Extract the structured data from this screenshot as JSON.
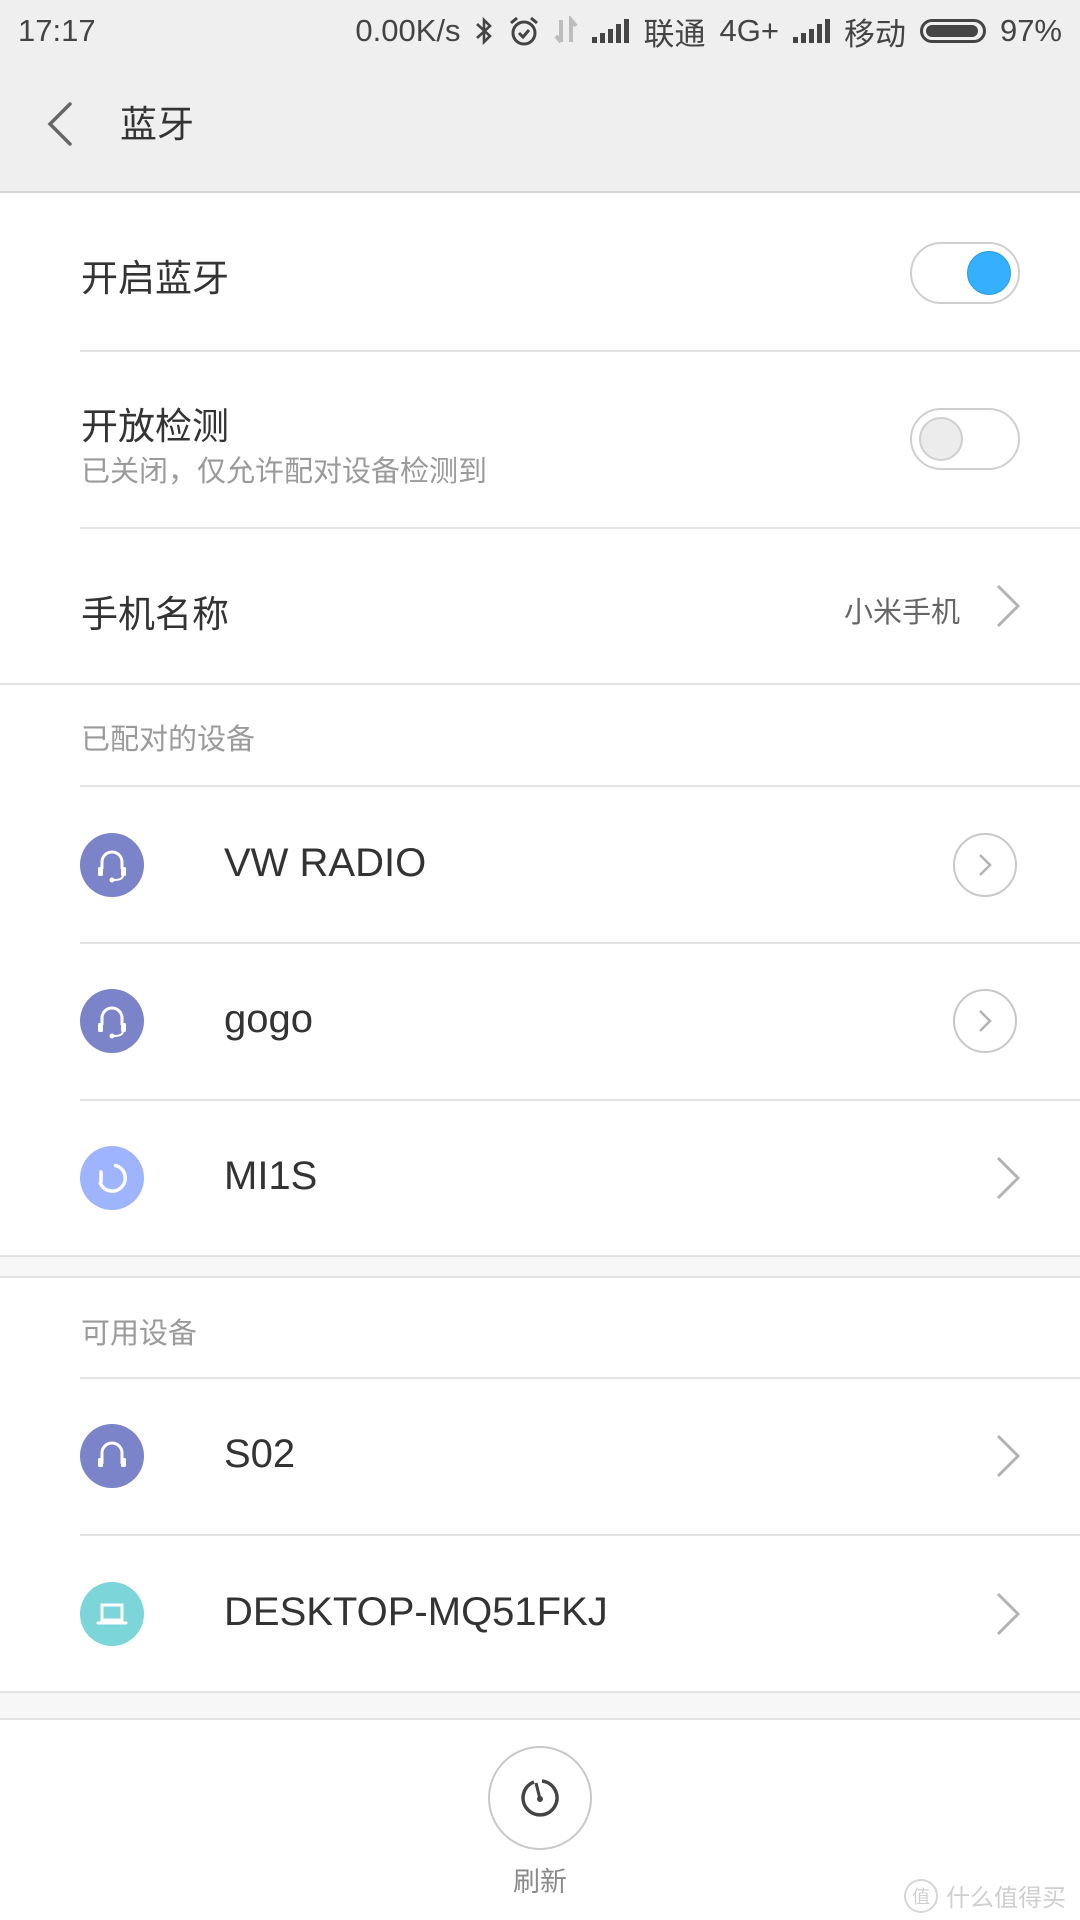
{
  "status_bar": {
    "time": "17:17",
    "net_speed": "0.00K/s",
    "icons": [
      "bluetooth-icon",
      "alarm-icon",
      "data-transfer-icon",
      "signal-icon",
      "signal-icon",
      "battery-icon"
    ],
    "carrier1": "联通",
    "carrier1_network": "4G+",
    "carrier2": "移动",
    "battery_percent": "97%",
    "battery_level": 0.97
  },
  "header": {
    "back_icon": "chevron-left-icon",
    "title": "蓝牙"
  },
  "settings": {
    "bluetooth": {
      "label": "开启蓝牙",
      "enabled": true,
      "accent": "#35b0ff"
    },
    "discoverable": {
      "label": "开放检测",
      "subtitle": "已关闭，仅允许配对设备检测到",
      "enabled": false
    },
    "phone_name": {
      "label": "手机名称",
      "value": "小米手机"
    }
  },
  "paired": {
    "header": "已配对的设备",
    "devices": [
      {
        "name": "VW RADIO",
        "icon": "headset-icon",
        "color": "#7b83c9",
        "action": "details"
      },
      {
        "name": "gogo",
        "icon": "headset-icon",
        "color": "#7b83c9",
        "action": "details"
      },
      {
        "name": "MI1S",
        "icon": "phone-loading-icon",
        "color": "#9fb4ff",
        "action": "chevron"
      }
    ]
  },
  "available": {
    "header": "可用设备",
    "devices": [
      {
        "name": "S02",
        "icon": "headphones-icon",
        "color": "#7b83c9",
        "action": "chevron"
      },
      {
        "name": "DESKTOP-MQ51FKJ",
        "icon": "laptop-icon",
        "color": "#7bd5d9",
        "action": "chevron"
      }
    ]
  },
  "footer": {
    "refresh_label": "刷新",
    "refresh_icon": "refresh-timer-icon"
  },
  "watermark": {
    "logo": "值",
    "text": "什么值得买"
  }
}
